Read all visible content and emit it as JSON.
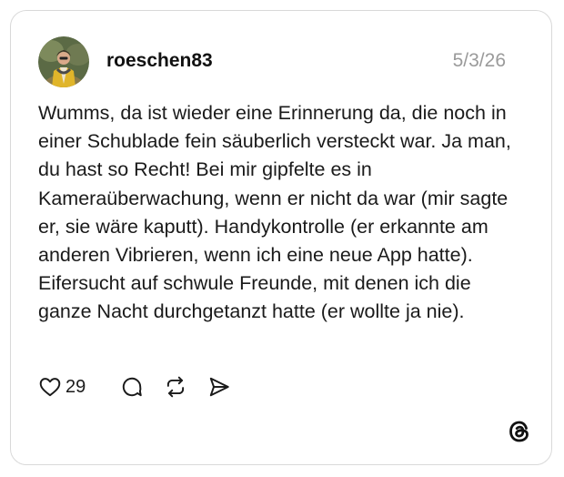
{
  "post": {
    "username": "roeschen83",
    "date": "5/3/26",
    "text": "Wumms, da ist wieder eine Erinnerung da, die noch in einer Schublade fein säuberlich versteckt war. Ja man, du hast so Recht! Bei mir gipfelte es in Kameraüberwachung, wenn er nicht da war (mir sagte er, sie wäre kaputt). Handykontrolle (er erkannte am anderen Vibrieren, wenn ich eine neue App hatte). Eifersucht auf schwule Freunde, mit denen ich die ganze Nacht durchgetanzt hatte (er wollte ja nie).",
    "like_count": "29"
  },
  "icons": {
    "like": "heart-icon",
    "comment": "comment-bubble-icon",
    "repost": "repost-icon",
    "share": "send-icon",
    "brand": "threads-logo-icon"
  },
  "colors": {
    "text": "#1a1a1a",
    "muted": "#9a9a9a",
    "border": "#d9d9d9"
  }
}
